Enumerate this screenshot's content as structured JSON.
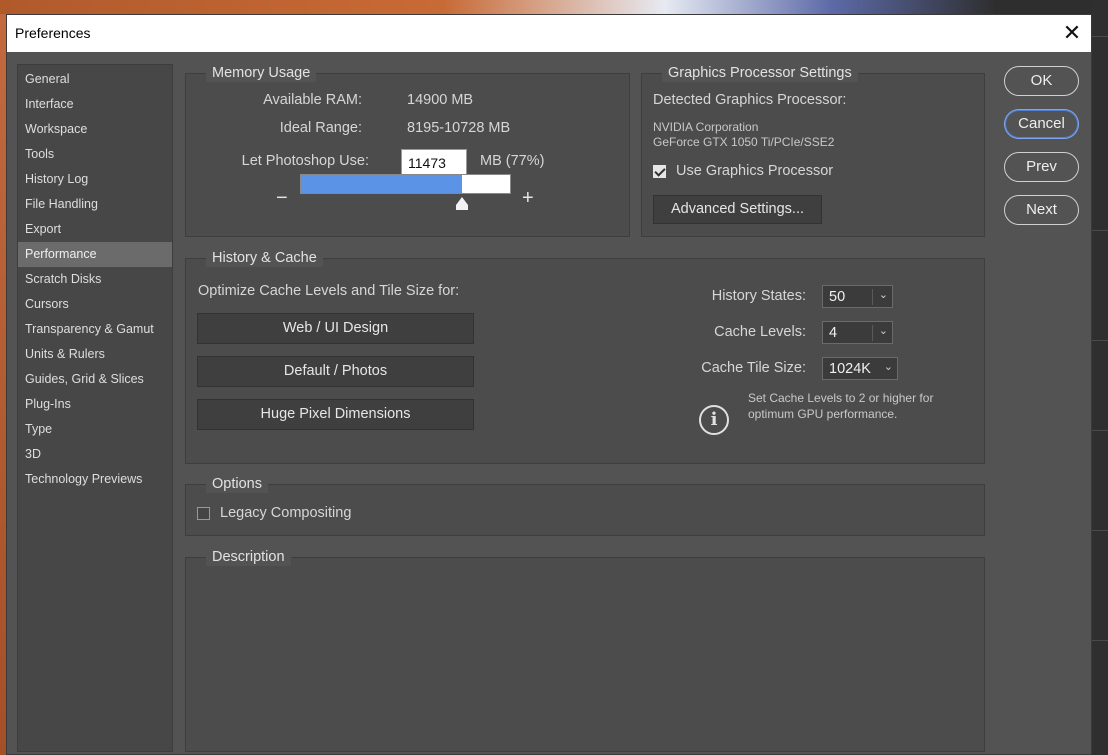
{
  "window": {
    "title": "Preferences",
    "close_glyph": "✕"
  },
  "sidebar": {
    "items": [
      {
        "label": "General"
      },
      {
        "label": "Interface"
      },
      {
        "label": "Workspace"
      },
      {
        "label": "Tools"
      },
      {
        "label": "History Log"
      },
      {
        "label": "File Handling"
      },
      {
        "label": "Export"
      },
      {
        "label": "Performance",
        "selected": true
      },
      {
        "label": "Scratch Disks"
      },
      {
        "label": "Cursors"
      },
      {
        "label": "Transparency & Gamut"
      },
      {
        "label": "Units & Rulers"
      },
      {
        "label": "Guides, Grid & Slices"
      },
      {
        "label": "Plug-Ins"
      },
      {
        "label": "Type"
      },
      {
        "label": "3D"
      },
      {
        "label": "Technology Previews"
      }
    ]
  },
  "memory": {
    "legend": "Memory Usage",
    "available_label": "Available RAM:",
    "available_value": "14900 MB",
    "ideal_label": "Ideal Range:",
    "ideal_value": "8195-10728 MB",
    "use_label": "Let Photoshop Use:",
    "use_value": "11473",
    "use_unit": "MB (77%)",
    "slider_fraction": 0.77,
    "minus": "−",
    "plus": "+"
  },
  "gpu": {
    "legend": "Graphics Processor Settings",
    "detected_label": "Detected Graphics Processor:",
    "vendor": "NVIDIA Corporation",
    "model": "GeForce GTX 1050 Ti/PCIe/SSE2",
    "use_gpu_label": "Use Graphics Processor",
    "use_gpu_checked": true,
    "advanced_button": "Advanced Settings..."
  },
  "buttons": {
    "ok": "OK",
    "cancel": "Cancel",
    "prev": "Prev",
    "next": "Next"
  },
  "history_cache": {
    "legend": "History & Cache",
    "optimize_label": "Optimize Cache Levels and Tile Size for:",
    "web_button": "Web / UI Design",
    "default_button": "Default / Photos",
    "huge_button": "Huge Pixel Dimensions",
    "history_states_label": "History States:",
    "history_states_value": "50",
    "cache_levels_label": "Cache Levels:",
    "cache_levels_value": "4",
    "tile_size_label": "Cache Tile Size:",
    "tile_size_value": "1024K",
    "info_text_1": "Set Cache Levels to 2 or higher for",
    "info_text_2": "optimum GPU performance.",
    "info_glyph": "i",
    "chevron_glyph": "⌄"
  },
  "options": {
    "legend": "Options",
    "legacy_label": "Legacy Compositing",
    "legacy_checked": false
  },
  "description": {
    "legend": "Description"
  },
  "colors": {
    "slider_fill": "#5b93e6",
    "selected_sidebar": "#6b6b6b",
    "dialog_bg": "#535353"
  }
}
